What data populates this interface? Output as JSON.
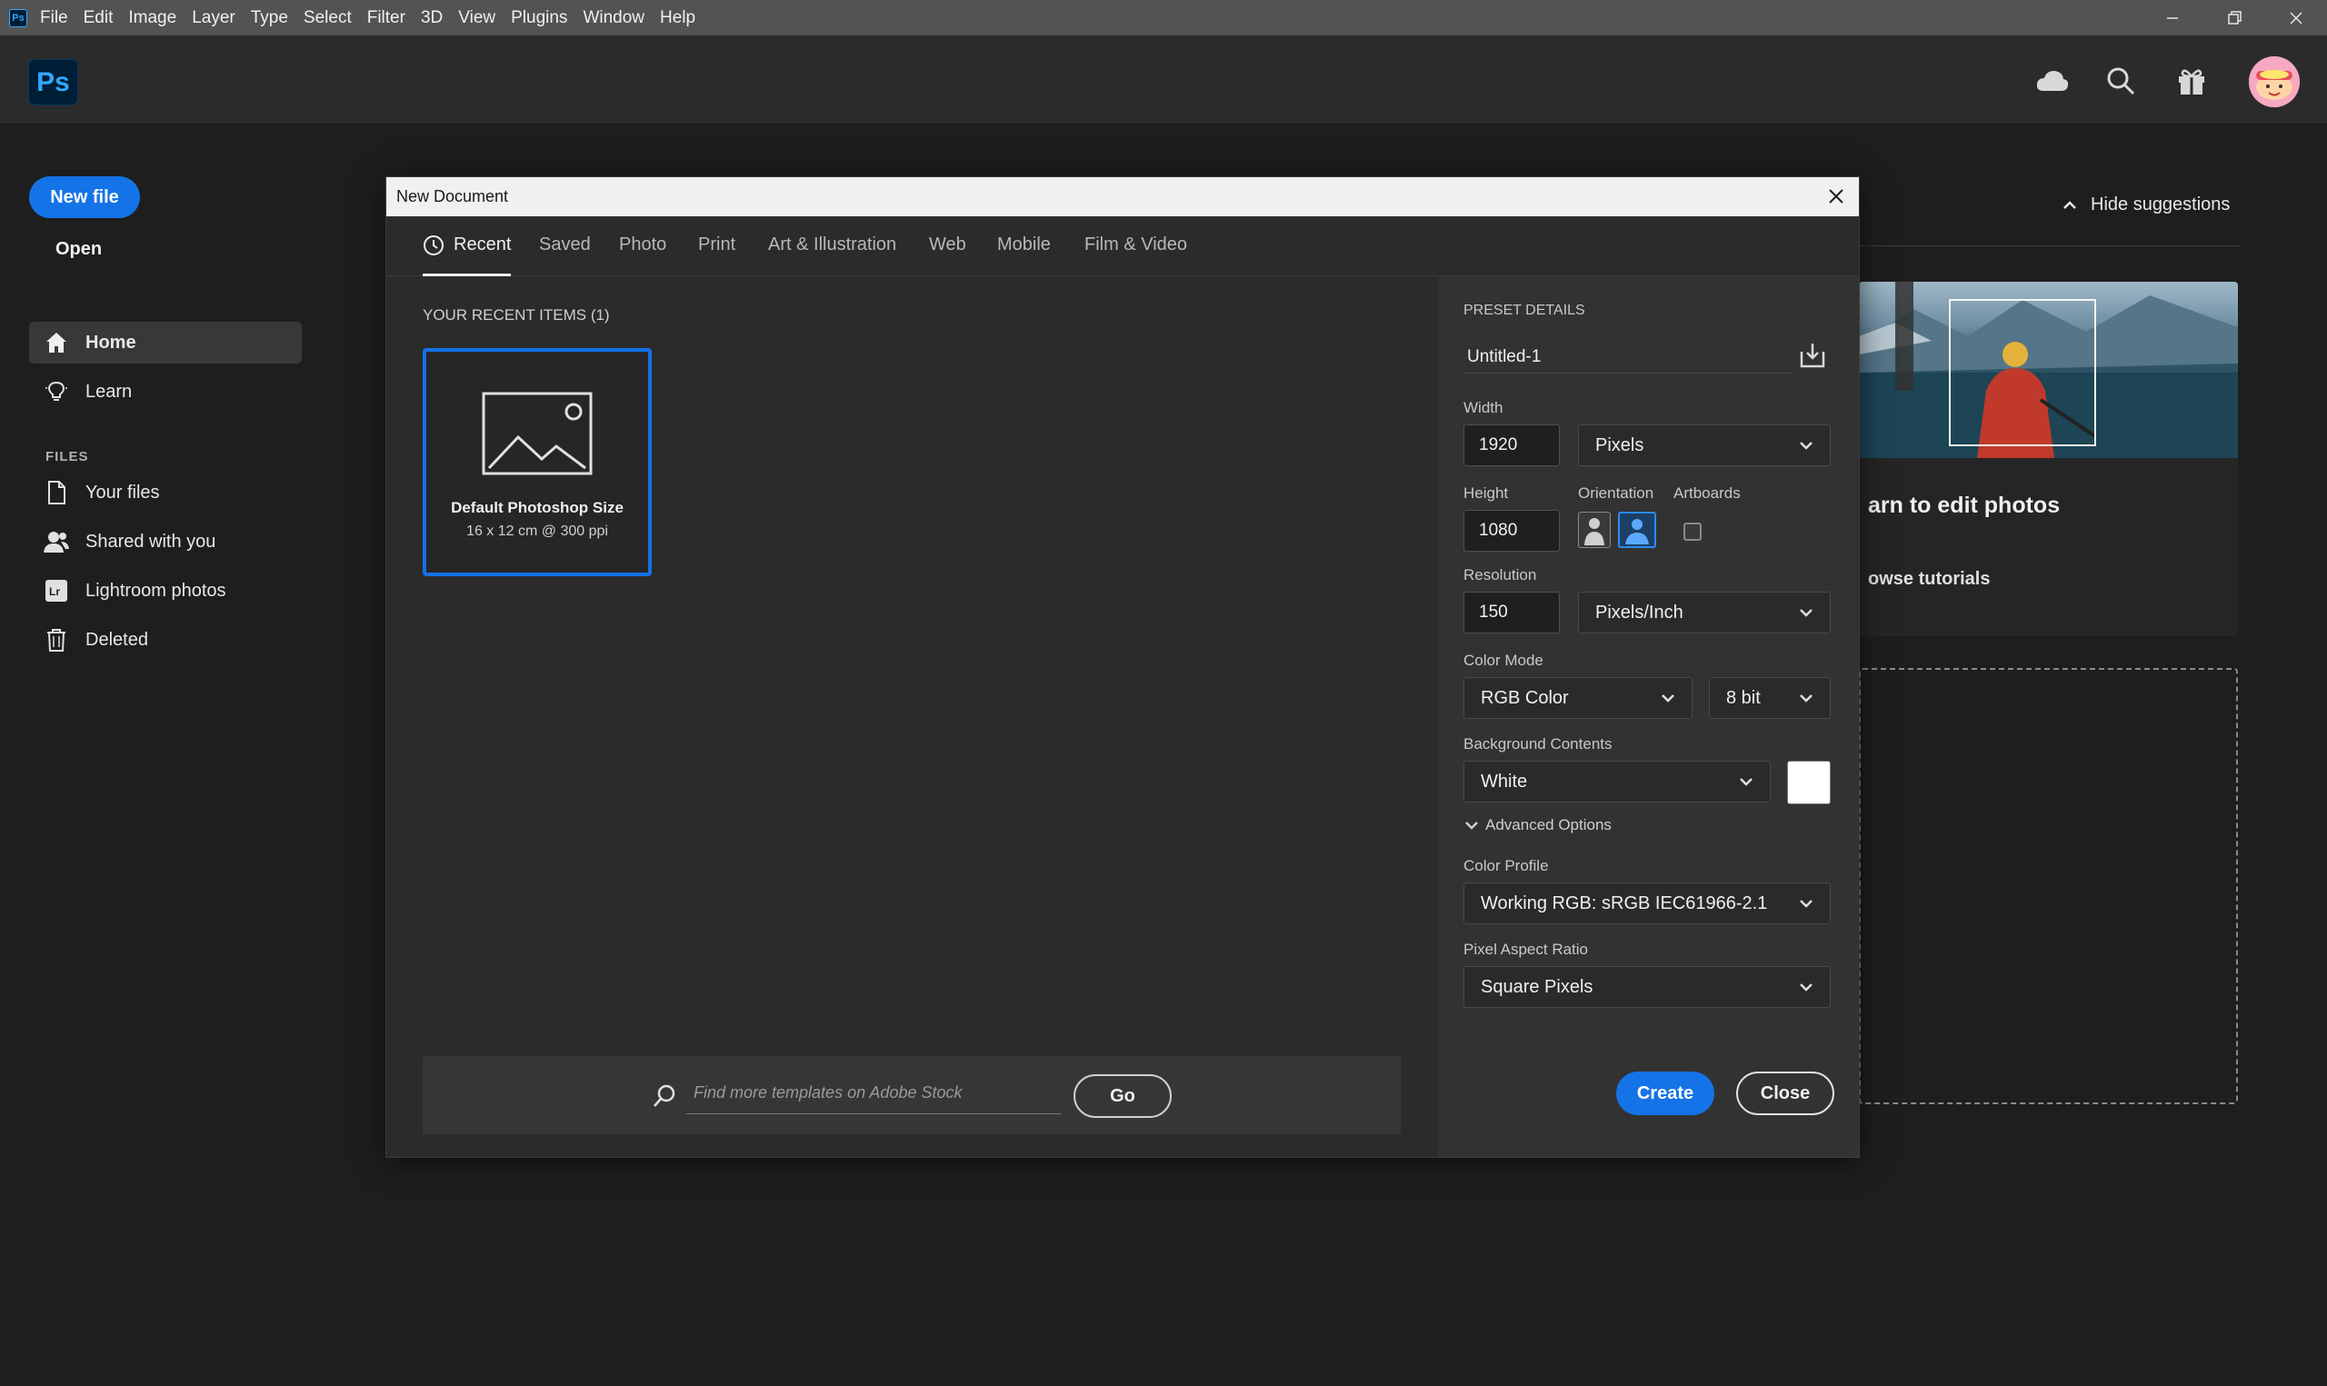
{
  "menubar": {
    "app_glyph": "Ps",
    "items": [
      "File",
      "Edit",
      "Image",
      "Layer",
      "Type",
      "Select",
      "Filter",
      "3D",
      "View",
      "Plugins",
      "Window",
      "Help"
    ]
  },
  "header": {
    "logo": "Ps",
    "icons": [
      "cloud-icon",
      "search-icon",
      "gift-icon",
      "avatar"
    ]
  },
  "sidebar": {
    "new_file": "New file",
    "open": "Open",
    "nav": [
      {
        "label": "Home",
        "icon": "home-icon"
      },
      {
        "label": "Learn",
        "icon": "lightbulb-icon"
      }
    ],
    "files_header": "FILES",
    "files": [
      {
        "label": "Your files",
        "icon": "file-icon"
      },
      {
        "label": "Shared with you",
        "icon": "shared-users-icon"
      },
      {
        "label": "Lightroom photos",
        "icon": "lightroom-icon"
      },
      {
        "label": "Deleted",
        "icon": "trash-icon"
      }
    ]
  },
  "suggestions": {
    "hide_label": "Hide suggestions",
    "card_title": "arn to edit photos",
    "card_link": "owse tutorials"
  },
  "dialog": {
    "title": "New Document",
    "tabs": [
      "Recent",
      "Saved",
      "Photo",
      "Print",
      "Art & Illustration",
      "Web",
      "Mobile",
      "Film & Video"
    ],
    "active_tab": "Recent",
    "recent_header": "YOUR RECENT ITEMS  (1)",
    "recent_item": {
      "name": "Default Photoshop Size",
      "detail": "16 x 12 cm @ 300 ppi"
    },
    "stock_placeholder": "Find more templates on Adobe Stock",
    "go_label": "Go",
    "preset": {
      "header": "PRESET DETAILS",
      "name": "Untitled-1",
      "width_label": "Width",
      "width_value": "1920",
      "width_unit": "Pixels",
      "height_label": "Height",
      "height_value": "1080",
      "orientation_label": "Orientation",
      "artboards_label": "Artboards",
      "resolution_label": "Resolution",
      "resolution_value": "150",
      "resolution_unit": "Pixels/Inch",
      "color_mode_label": "Color Mode",
      "color_mode": "RGB Color",
      "bit_depth": "8 bit",
      "bg_label": "Background Contents",
      "bg_value": "White",
      "bg_color": "#ffffff",
      "advanced_label": "Advanced Options",
      "profile_label": "Color Profile",
      "profile_value": "Working RGB: sRGB IEC61966-2.1",
      "aspect_label": "Pixel Aspect Ratio",
      "aspect_value": "Square Pixels",
      "create_label": "Create",
      "close_label": "Close"
    }
  },
  "colors": {
    "accent": "#1473e6",
    "dialog_bg": "#2b2b2b",
    "panel_bg": "#323232"
  }
}
